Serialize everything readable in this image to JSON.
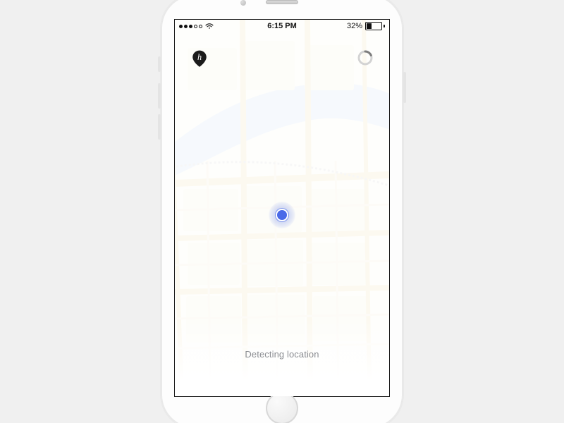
{
  "statusbar": {
    "time": "6:15 PM",
    "battery_percent_label": "32%",
    "battery_percent": 32,
    "signal_filled": 3,
    "signal_total": 5
  },
  "app": {
    "logo_letter": "h",
    "status_text": "Detecting location"
  },
  "icons": {
    "logo": "app-logo-pin-icon",
    "spinner": "loading-spinner-icon",
    "wifi": "wifi-icon",
    "battery": "battery-icon",
    "user_location": "user-location-dot-icon"
  },
  "colors": {
    "accent": "#4a6ae8",
    "text_muted": "#8b8d92",
    "river": "#c9def2",
    "road": "#f4edd7"
  }
}
